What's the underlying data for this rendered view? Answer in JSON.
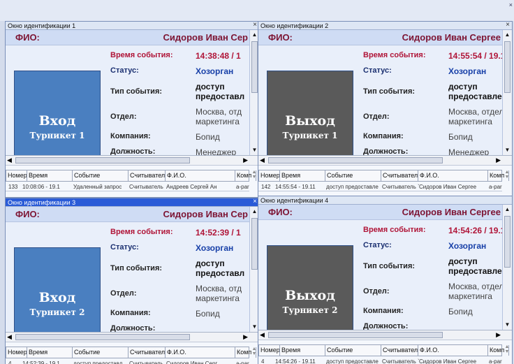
{
  "top_close": "×",
  "labels": {
    "fio": "ФИО:",
    "time": "Время события:",
    "status": "Статус:",
    "event_type": "Тип события:",
    "department": "Отдел:",
    "company": "Компания:",
    "position": "Должность:"
  },
  "columns": [
    "Номер",
    "Время",
    "Событие",
    "Считыватель",
    "Ф.И.О.",
    "Комп"
  ],
  "windows": [
    {
      "title": "Окно идентификации 1",
      "close": "×",
      "fio": "Сидоров Иван Сер",
      "time": "14:38:48 / 1",
      "status": "Хозорган",
      "event_type_1": "доступ",
      "event_type_2": "предоставл",
      "department_1": "Москва, отд",
      "department_2": "маркетинга",
      "company": "Бопид",
      "position": "Менеджер",
      "direction": "Вход",
      "turnstile": "Турникет 1",
      "row": {
        "num": "133",
        "time": "10:08:06 - 19.1",
        "event": "Удаленный запрос",
        "reader": "Считыватель",
        "fio": "Андреев Сергей Ан",
        "comp": "a-par"
      }
    },
    {
      "title": "Окно идентификации 2",
      "close": "×",
      "fio": "Сидоров Иван Сергее",
      "time": "14:55:54 / 19.1",
      "status": "Хозорган",
      "event_type_1": "доступ",
      "event_type_2": "предоставлен",
      "department_1": "Москва, отдел",
      "department_2": "маркетинга",
      "company": "Бопид",
      "position": "Менеджер",
      "direction": "Выход",
      "turnstile": "Турникет 1",
      "row": {
        "num": "142",
        "time": "14:55:54 - 19.11",
        "event": "доступ предоставле",
        "reader": "Считыватель `",
        "fio": "Сидоров Иван Сергее",
        "comp": "a-par"
      }
    },
    {
      "title": "Окно идентификации 3",
      "close": "×",
      "fio": "Сидоров Иван Сер",
      "time": "14:52:39 / 1",
      "status": "Хозорган",
      "event_type_1": "доступ",
      "event_type_2": "предоставл",
      "department_1": "Москва, отд",
      "department_2": "маркетинга",
      "company": "Бопид",
      "position": "",
      "direction": "Вход",
      "turnstile": "Турникет 2",
      "row": {
        "num": "4",
        "time": "14:52:39 - 19.1",
        "event": "доступ предоставл",
        "reader": "Считыватель",
        "fio": "Сидоров Иван Серг",
        "comp": "a-par"
      }
    },
    {
      "title": "Окно идентификации 4",
      "close": "",
      "fio": "Сидоров Иван Сергее",
      "time": "14:54:26 / 19.1",
      "status": "Хозорган",
      "event_type_1": "доступ",
      "event_type_2": "предоставлен",
      "department_1": "Москва, отдел",
      "department_2": "маркетинга",
      "company": "Бопид",
      "position": "",
      "direction": "Выход",
      "turnstile": "Турникет 2",
      "row": {
        "num": "4",
        "time": "14:54:26 - 19.11",
        "event": "доступ предоставле",
        "reader": "Считыватель `",
        "fio": "Сидоров Иван Сергее",
        "comp": "a-par"
      }
    }
  ]
}
